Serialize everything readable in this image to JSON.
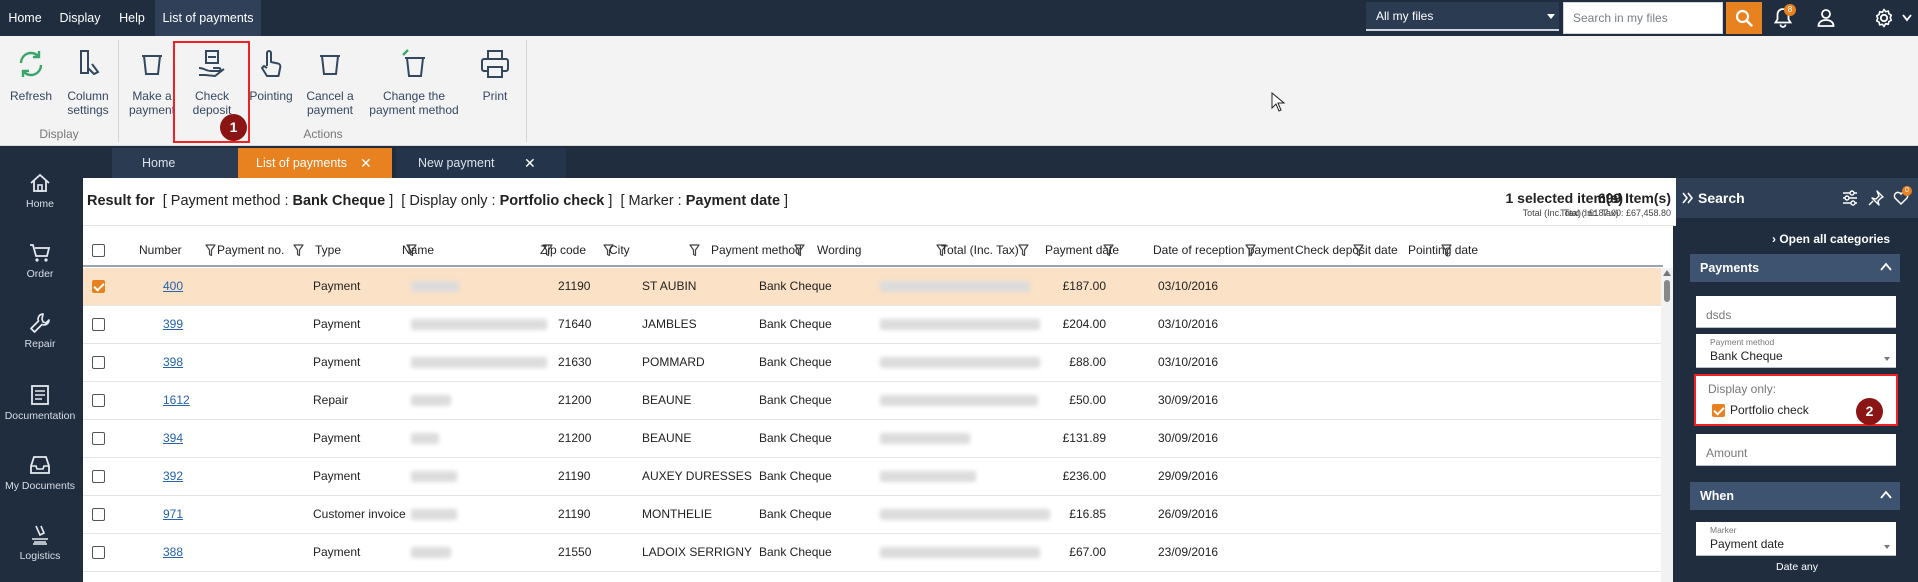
{
  "menu": {
    "home": "Home",
    "display": "Display",
    "help": "Help",
    "list": "List of payments"
  },
  "header": {
    "files_select": "All my files",
    "search_placeholder": "Search in my files",
    "notifications_count": "8"
  },
  "ribbon": {
    "refresh": "Refresh",
    "column_settings": "Column\nsettings",
    "make_payment": "Make a\npayment",
    "check_deposit": "Check\ndeposit",
    "pointing": "Pointing",
    "cancel_payment": "Cancel a\npayment",
    "change_method": "Change the\npayment method",
    "print": "Print",
    "group_display": "Display",
    "group_actions": "Actions"
  },
  "markers": {
    "one": "1",
    "two": "2"
  },
  "leftnav": {
    "home": "Home",
    "order": "Order",
    "repair": "Repair",
    "documentation": "Documentation",
    "my_documents": "My Documents",
    "logistics": "Logistics"
  },
  "tabs": {
    "home": "Home",
    "list": "List of payments",
    "new": "New payment"
  },
  "result": {
    "prefix": "Result for",
    "f1_label": "Payment method :",
    "f1_value": "Bank Cheque",
    "f2_label": "Display only :",
    "f2_value": "Portfolio check",
    "f3_label": "Marker :",
    "f3_value": "Payment date",
    "selected": "1  selected item(s)",
    "selected_total": "Total (Inc. Tax) : £187.00",
    "items": "699  Item(s)",
    "items_total": "Total (Inc. Tax) : £67,458.80"
  },
  "columns": [
    "Number",
    "Payment no.",
    "Type",
    "Name",
    "Zip code",
    "City",
    "Payment method",
    "Wording",
    "Total (Inc. Tax)",
    "Payment date",
    "Date of reception payment",
    "Check deposit date",
    "Pointing date"
  ],
  "rows": [
    {
      "number": "400",
      "type": "Payment",
      "zip": "21190",
      "city": "ST AUBIN",
      "method": "Bank Cheque",
      "total": "£187.00",
      "date": "03/10/2016",
      "selected": true
    },
    {
      "number": "399",
      "type": "Payment",
      "zip": "71640",
      "city": "JAMBLES",
      "method": "Bank Cheque",
      "total": "£204.00",
      "date": "03/10/2016",
      "selected": false
    },
    {
      "number": "398",
      "type": "Payment",
      "zip": "21630",
      "city": "POMMARD",
      "method": "Bank Cheque",
      "total": "£88.00",
      "date": "03/10/2016",
      "selected": false
    },
    {
      "number": "1612",
      "type": "Repair",
      "zip": "21200",
      "city": "BEAUNE",
      "method": "Bank Cheque",
      "total": "£50.00",
      "date": "30/09/2016",
      "selected": false
    },
    {
      "number": "394",
      "type": "Payment",
      "zip": "21200",
      "city": "BEAUNE",
      "method": "Bank Cheque",
      "total": "£131.89",
      "date": "30/09/2016",
      "selected": false
    },
    {
      "number": "392",
      "type": "Payment",
      "zip": "21190",
      "city": "AUXEY DURESSES",
      "method": "Bank Cheque",
      "total": "£236.00",
      "date": "29/09/2016",
      "selected": false
    },
    {
      "number": "971",
      "type": "Customer invoice",
      "zip": "21190",
      "city": "MONTHELIE",
      "method": "Bank Cheque",
      "total": "£16.85",
      "date": "26/09/2016",
      "selected": false
    },
    {
      "number": "388",
      "type": "Payment",
      "zip": "21550",
      "city": "LADOIX SERRIGNY",
      "method": "Bank Cheque",
      "total": "£67.00",
      "date": "23/09/2016",
      "selected": false
    }
  ],
  "panel": {
    "title": "Search",
    "open_all": "Open all categories",
    "payments": "Payments",
    "text_value": "dsds",
    "method_label": "Payment method",
    "method_value": "Bank Cheque",
    "display_only": "Display only:",
    "portfolio": "Portfolio check",
    "amount_placeholder": "Amount",
    "when": "When",
    "marker_label": "Marker",
    "marker_value": "Payment date",
    "date_any": "Date any",
    "badge": "0"
  },
  "colors": {
    "accent": "#e8811f",
    "navy": "#1f2d3f",
    "selected_row": "#fbe1c6",
    "highlight": "#e22222"
  }
}
